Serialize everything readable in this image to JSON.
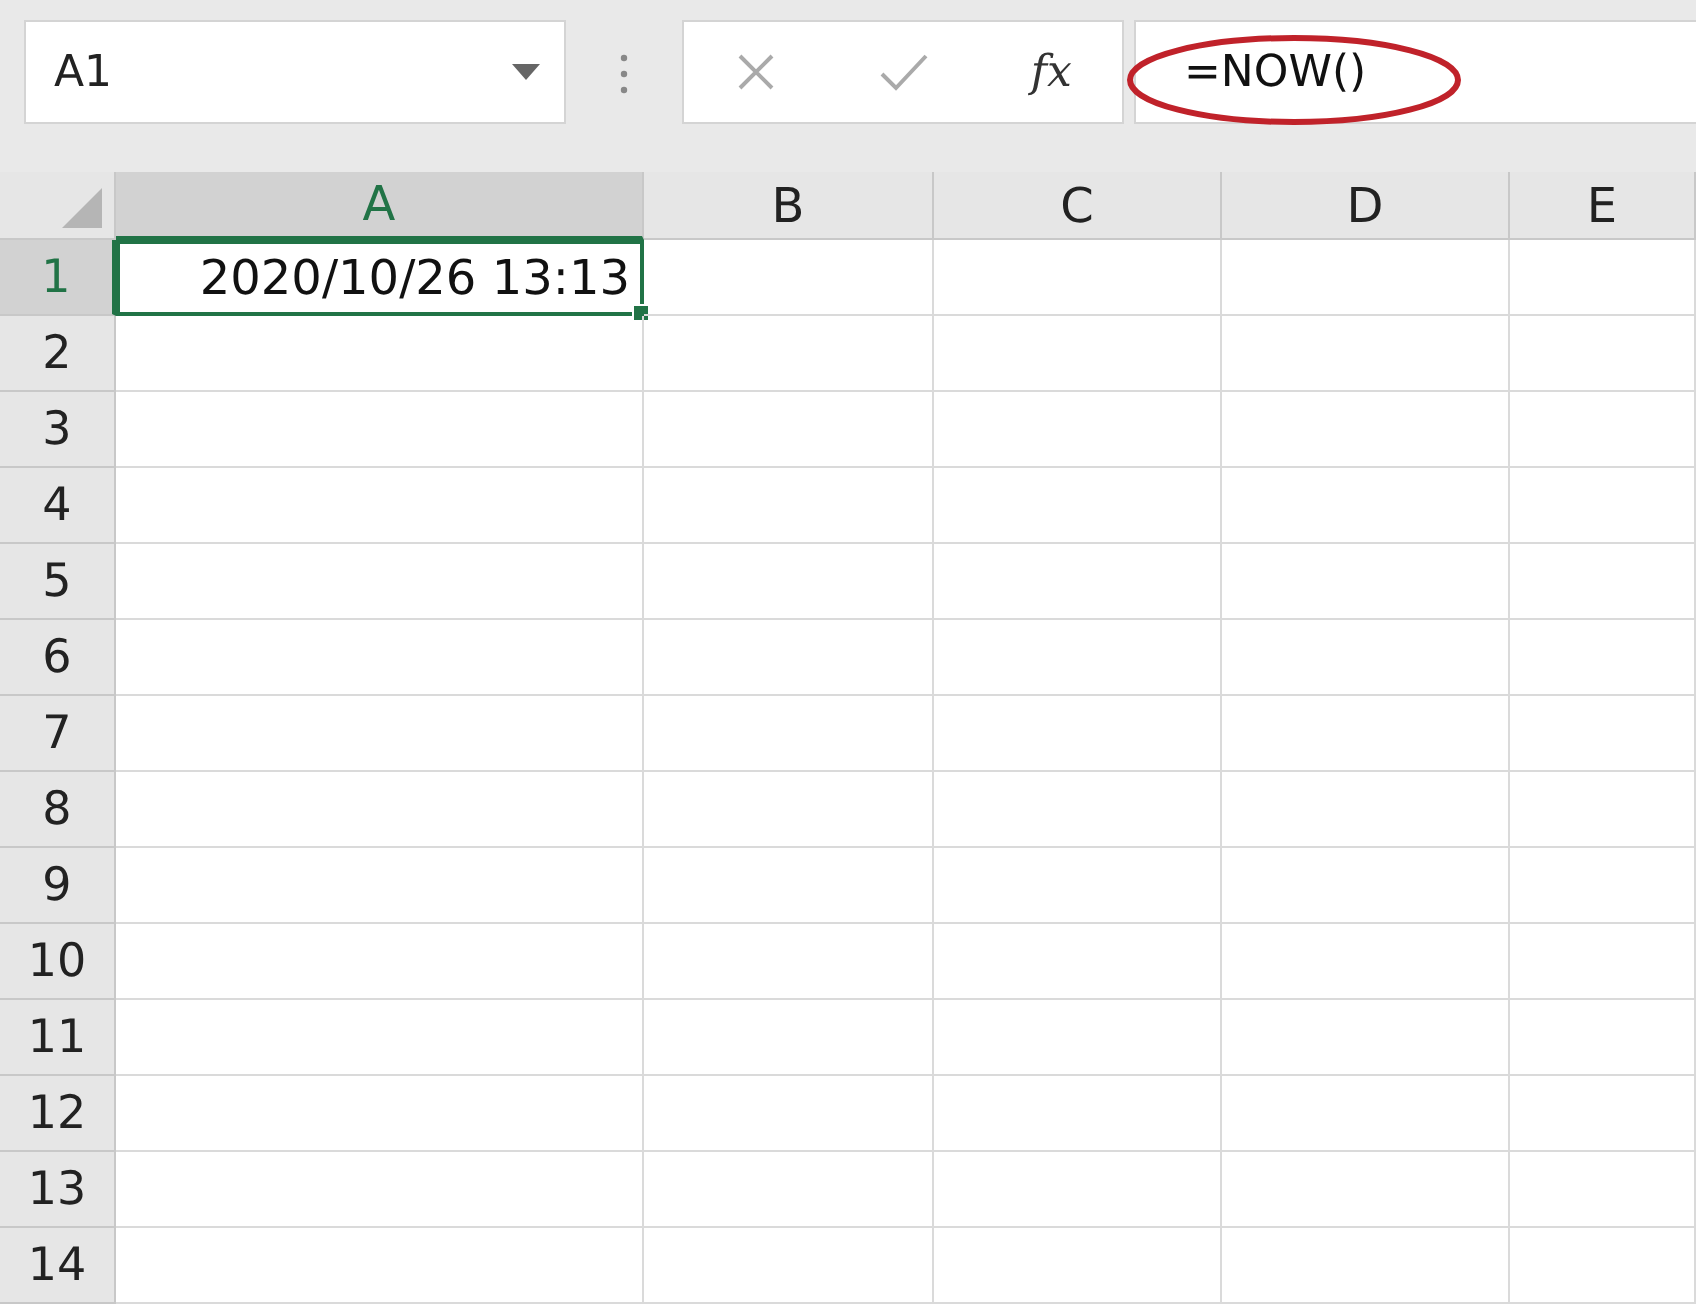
{
  "name_box": {
    "value": "A1"
  },
  "formula_bar": {
    "function_label": "fx",
    "value": "=NOW()",
    "highlighted": true
  },
  "columns": [
    {
      "label": "A",
      "selected": true
    },
    {
      "label": "B",
      "selected": false
    },
    {
      "label": "C",
      "selected": false
    },
    {
      "label": "D",
      "selected": false
    },
    {
      "label": "E",
      "selected": false
    }
  ],
  "rows": [
    {
      "label": "1",
      "selected": true,
      "values": [
        "2020/10/26 13:13"
      ]
    },
    {
      "label": "2",
      "selected": false
    },
    {
      "label": "3",
      "selected": false
    },
    {
      "label": "4",
      "selected": false
    },
    {
      "label": "5",
      "selected": false
    },
    {
      "label": "6",
      "selected": false
    },
    {
      "label": "7",
      "selected": false
    },
    {
      "label": "8",
      "selected": false
    },
    {
      "label": "9",
      "selected": false
    },
    {
      "label": "10",
      "selected": false
    },
    {
      "label": "11",
      "selected": false
    },
    {
      "label": "12",
      "selected": false
    },
    {
      "label": "13",
      "selected": false
    },
    {
      "label": "14",
      "selected": false
    }
  ]
}
